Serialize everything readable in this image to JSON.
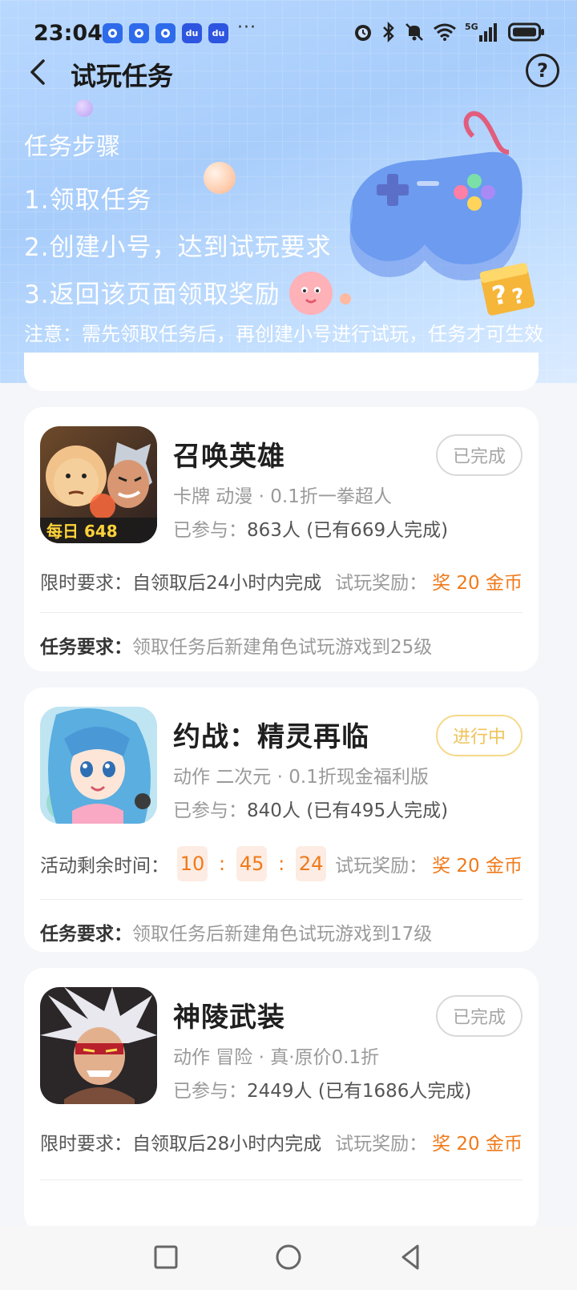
{
  "status_bar": {
    "time": "23:04",
    "more": "···",
    "app_icons": [
      "app-icon",
      "app-icon",
      "app-icon",
      "baidu-icon",
      "baidu-icon"
    ],
    "right_icons": [
      "alarm-icon",
      "bluetooth-icon",
      "mute-icon",
      "wifi-icon",
      "5g-signal-icon",
      "battery-icon"
    ],
    "network": "5G"
  },
  "nav": {
    "title": "试玩任务",
    "help": "?"
  },
  "steps": {
    "title": "任务步骤",
    "items": [
      "1.领取任务",
      "2.创建小号，达到试玩要求",
      "3.返回该页面领取奖励"
    ],
    "notice": "注意：需先领取任务后，再创建小号进行试玩，任务才可生效"
  },
  "cards": [
    {
      "name": "召唤英雄",
      "tags": "卡牌 动漫 · 0.1折一拳超人",
      "joined_label": "已参与：",
      "joined_value": "863人 (已有669人完成)",
      "status": "已完成",
      "limit_label": "限时要求：",
      "limit_value": "自领取后24小时内完成",
      "reward_label": "试玩奖励：",
      "reward_value": "奖 20 金币",
      "req_label": "任务要求：",
      "req_value": "领取任务后新建角色试玩游戏到25级",
      "icon_text": "每日 648"
    },
    {
      "name": "约战：精灵再临",
      "tags": "动作 二次元 · 0.1折现金福利版",
      "joined_label": "已参与：",
      "joined_value": "840人 (已有495人完成)",
      "status": "进行中",
      "timer_label": "活动剩余时间：",
      "timer_h": "10",
      "timer_m": "45",
      "timer_s": "24",
      "colon": ":",
      "reward_label": "试玩奖励：",
      "reward_value": "奖 20 金币",
      "req_label": "任务要求：",
      "req_value": "领取任务后新建角色试玩游戏到17级"
    },
    {
      "name": "神陵武装",
      "tags": "动作 冒险 · 真·原价0.1折",
      "joined_label": "已参与：",
      "joined_value": "2449人 (已有1686人完成)",
      "status": "已完成",
      "limit_label": "限时要求：",
      "limit_value": "自领取后28小时内完成",
      "reward_label": "试玩奖励：",
      "reward_value": "奖 20 金币"
    }
  ],
  "colors": {
    "accent_orange": "#f07a1a",
    "hero_blue": "#a8cdfb",
    "ongoing_yellow": "#f0c35a"
  }
}
